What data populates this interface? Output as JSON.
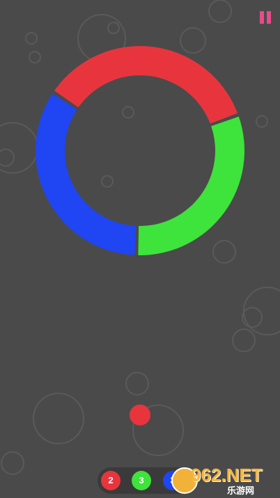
{
  "game": {
    "colors": {
      "background": "#4a4a4a",
      "red": "#e8353d",
      "green": "#3ee33c",
      "blue": "#1f46f2",
      "pause": "#e94a8a",
      "hud_background": "#3a3a3a"
    },
    "ring_segments": [
      {
        "color": "red"
      },
      {
        "color": "green"
      },
      {
        "color": "blue"
      }
    ],
    "ball": {
      "color": "red"
    },
    "hud": {
      "tokens": [
        {
          "value": "2",
          "color": "red"
        },
        {
          "value": "3",
          "color": "green"
        },
        {
          "value": "3",
          "color": "blue"
        }
      ]
    },
    "pause_icon": "pause-icon"
  },
  "watermark": {
    "brand": "962.NET",
    "subtitle": "乐游网"
  }
}
